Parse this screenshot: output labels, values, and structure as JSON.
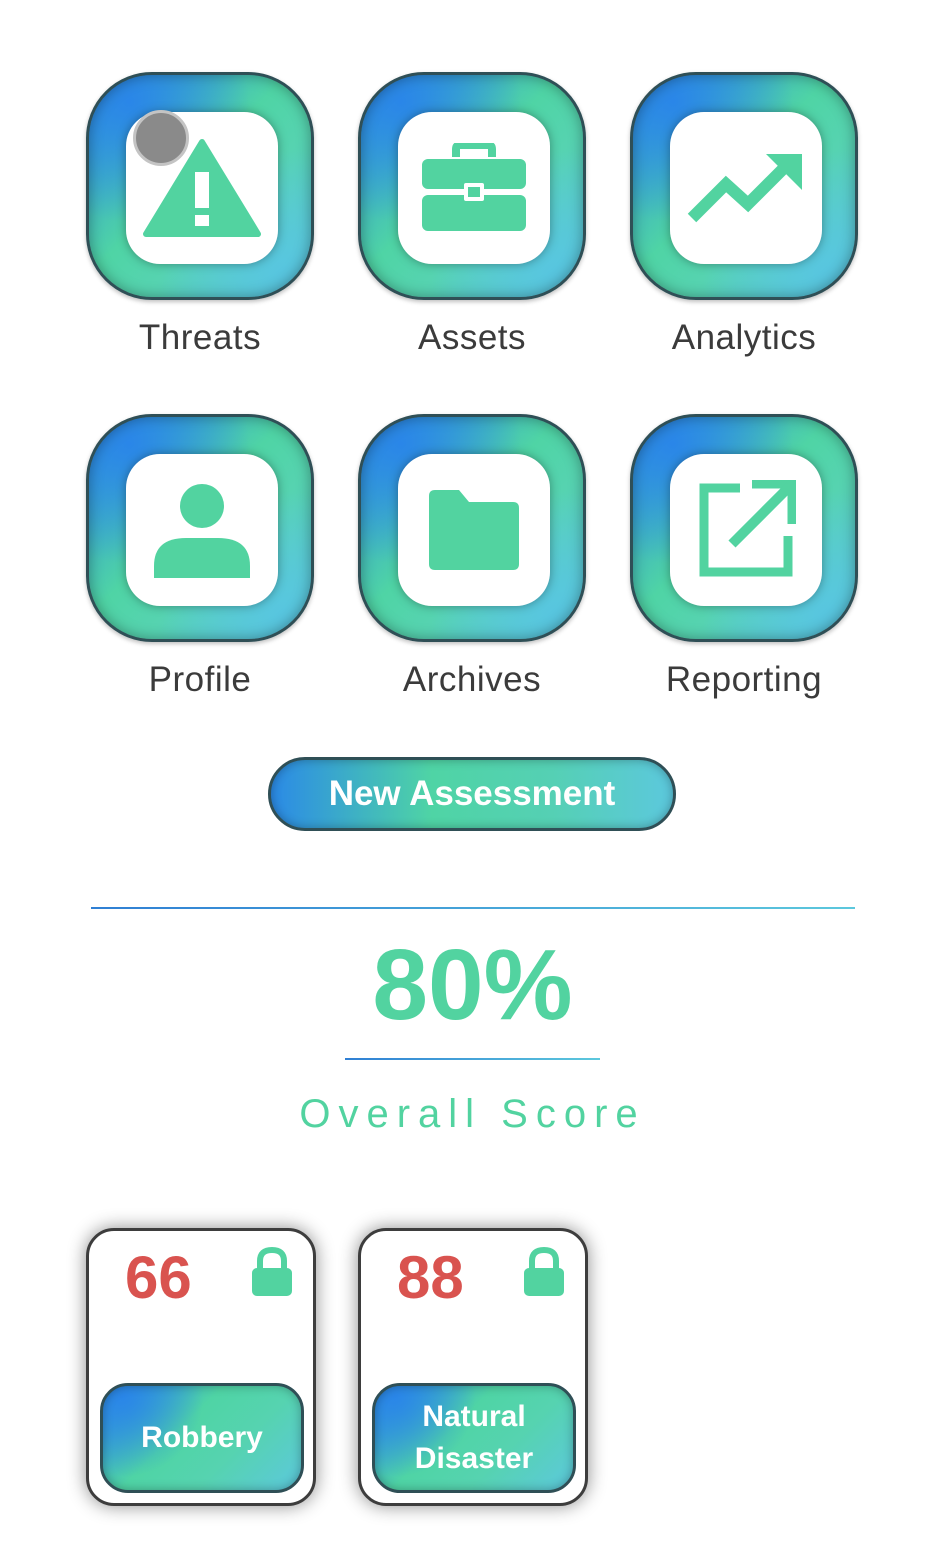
{
  "tiles": [
    {
      "label": "Threats",
      "icon": "warning-icon"
    },
    {
      "label": "Assets",
      "icon": "briefcase-icon"
    },
    {
      "label": "Analytics",
      "icon": "trending-up-icon"
    },
    {
      "label": "Profile",
      "icon": "user-icon"
    },
    {
      "label": "Archives",
      "icon": "folder-icon"
    },
    {
      "label": "Reporting",
      "icon": "external-link-icon"
    }
  ],
  "new_assessment": {
    "label": "New Assessment"
  },
  "score": {
    "value": "80%",
    "label": "Overall Score"
  },
  "cards": [
    {
      "value": "66",
      "label_line1": "Robbery",
      "label_line2": "",
      "locked": true
    },
    {
      "value": "88",
      "label_line1": "Natural",
      "label_line2": "Disaster",
      "locked": true
    }
  ],
  "colors": {
    "accent": "#52d3a0",
    "gradient_blue": "#2b8ae6",
    "gradient_cyan": "#5cc8dd",
    "score_red": "#d9534f",
    "label_text": "#3b3b3b"
  }
}
